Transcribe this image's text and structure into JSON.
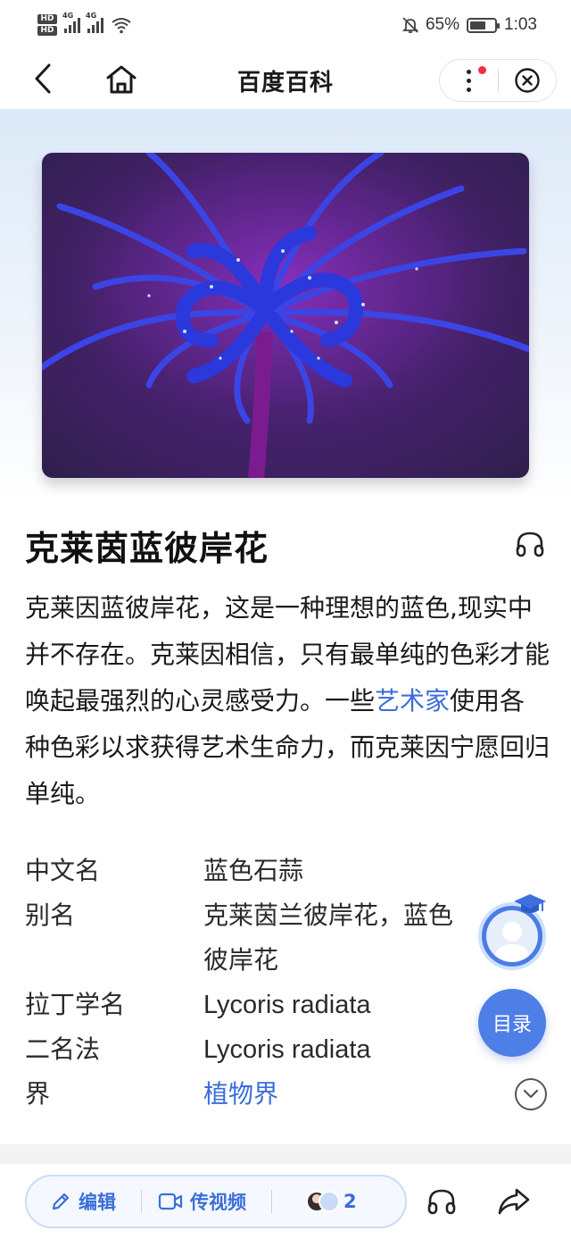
{
  "status_bar": {
    "hd1": "HD",
    "hd2": "HD",
    "net1": "4G",
    "net2": "4G",
    "battery": "65%",
    "battery_level": 0.65,
    "time": "1:03"
  },
  "nav": {
    "title": "百度百科"
  },
  "article": {
    "title": "克莱茵蓝彼岸花",
    "summary_part1": "克莱因蓝彼岸花，这是一种理想的蓝色,现实中并不存在。克莱因相信，只有最单纯的色彩才能唤起最强烈的心灵感受力。一些",
    "summary_link": "艺术家",
    "summary_part2": "使用各种色彩以求获得艺术生命力，而克莱因宁愿回归单纯。"
  },
  "infobox": {
    "rows": [
      {
        "key": "中文名",
        "value": "蓝色石蒜"
      },
      {
        "key": "别名",
        "value": "克莱茵兰彼岸花，蓝色彼岸花"
      },
      {
        "key": "拉丁学名",
        "value": "Lycoris radiata"
      },
      {
        "key": "二名法",
        "value": "Lycoris radiata"
      },
      {
        "key": "界",
        "value": "植物界"
      }
    ]
  },
  "floating": {
    "toc": "目录"
  },
  "bottom_bar": {
    "edit": "编辑",
    "video": "传视频",
    "contributors": "2"
  },
  "colors": {
    "accent": "#3b6ed8",
    "toc_bg": "#4e7fe6",
    "notify_dot": "#f0303a"
  }
}
